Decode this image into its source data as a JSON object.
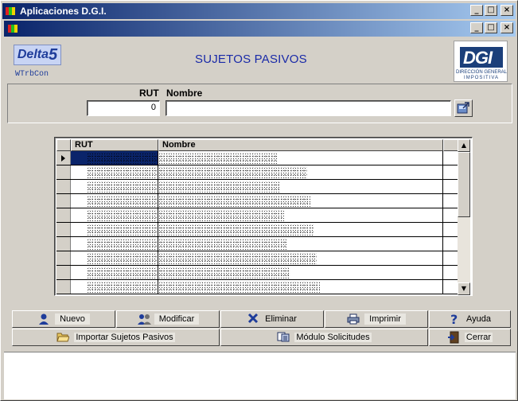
{
  "window": {
    "title": "Aplicaciones  D.G.I."
  },
  "header": {
    "product_logo_text": "Delta",
    "product_logo_number": "5",
    "module_code": "WTrbCon",
    "page_title": "SUJETOS PASIVOS",
    "org_logo": {
      "mark": "DGI",
      "line1": "DIRECCIÓN GENERAL",
      "line2": "IMPOSITIVA"
    }
  },
  "search": {
    "rut_label": "RUT",
    "nombre_label": "Nombre",
    "rut_value": "0",
    "nombre_value": ""
  },
  "grid": {
    "columns": [
      "RUT",
      "Nombre"
    ],
    "row_count": 10
  },
  "buttons": {
    "nuevo": "Nuevo",
    "modificar": "Modificar",
    "eliminar": "Eliminar",
    "imprimir": "Imprimir",
    "ayuda": "Ayuda",
    "importar": "Importar Sujetos Pasivos",
    "modulo": "Módulo Solicitudes",
    "cerrar": "Cerrar"
  },
  "colors": {
    "title_gradient_start": "#0a246a",
    "title_gradient_end": "#a6caf0",
    "page_title": "#1a2aa8",
    "selection": "#0a246a"
  },
  "icons": [
    "app-icon",
    "minimize-icon",
    "maximize-icon",
    "close-icon",
    "search-icon",
    "user-icon",
    "users-icon",
    "delete-x-icon",
    "printer-icon",
    "help-icon",
    "folder-open-icon",
    "module-icon",
    "exit-door-icon"
  ]
}
